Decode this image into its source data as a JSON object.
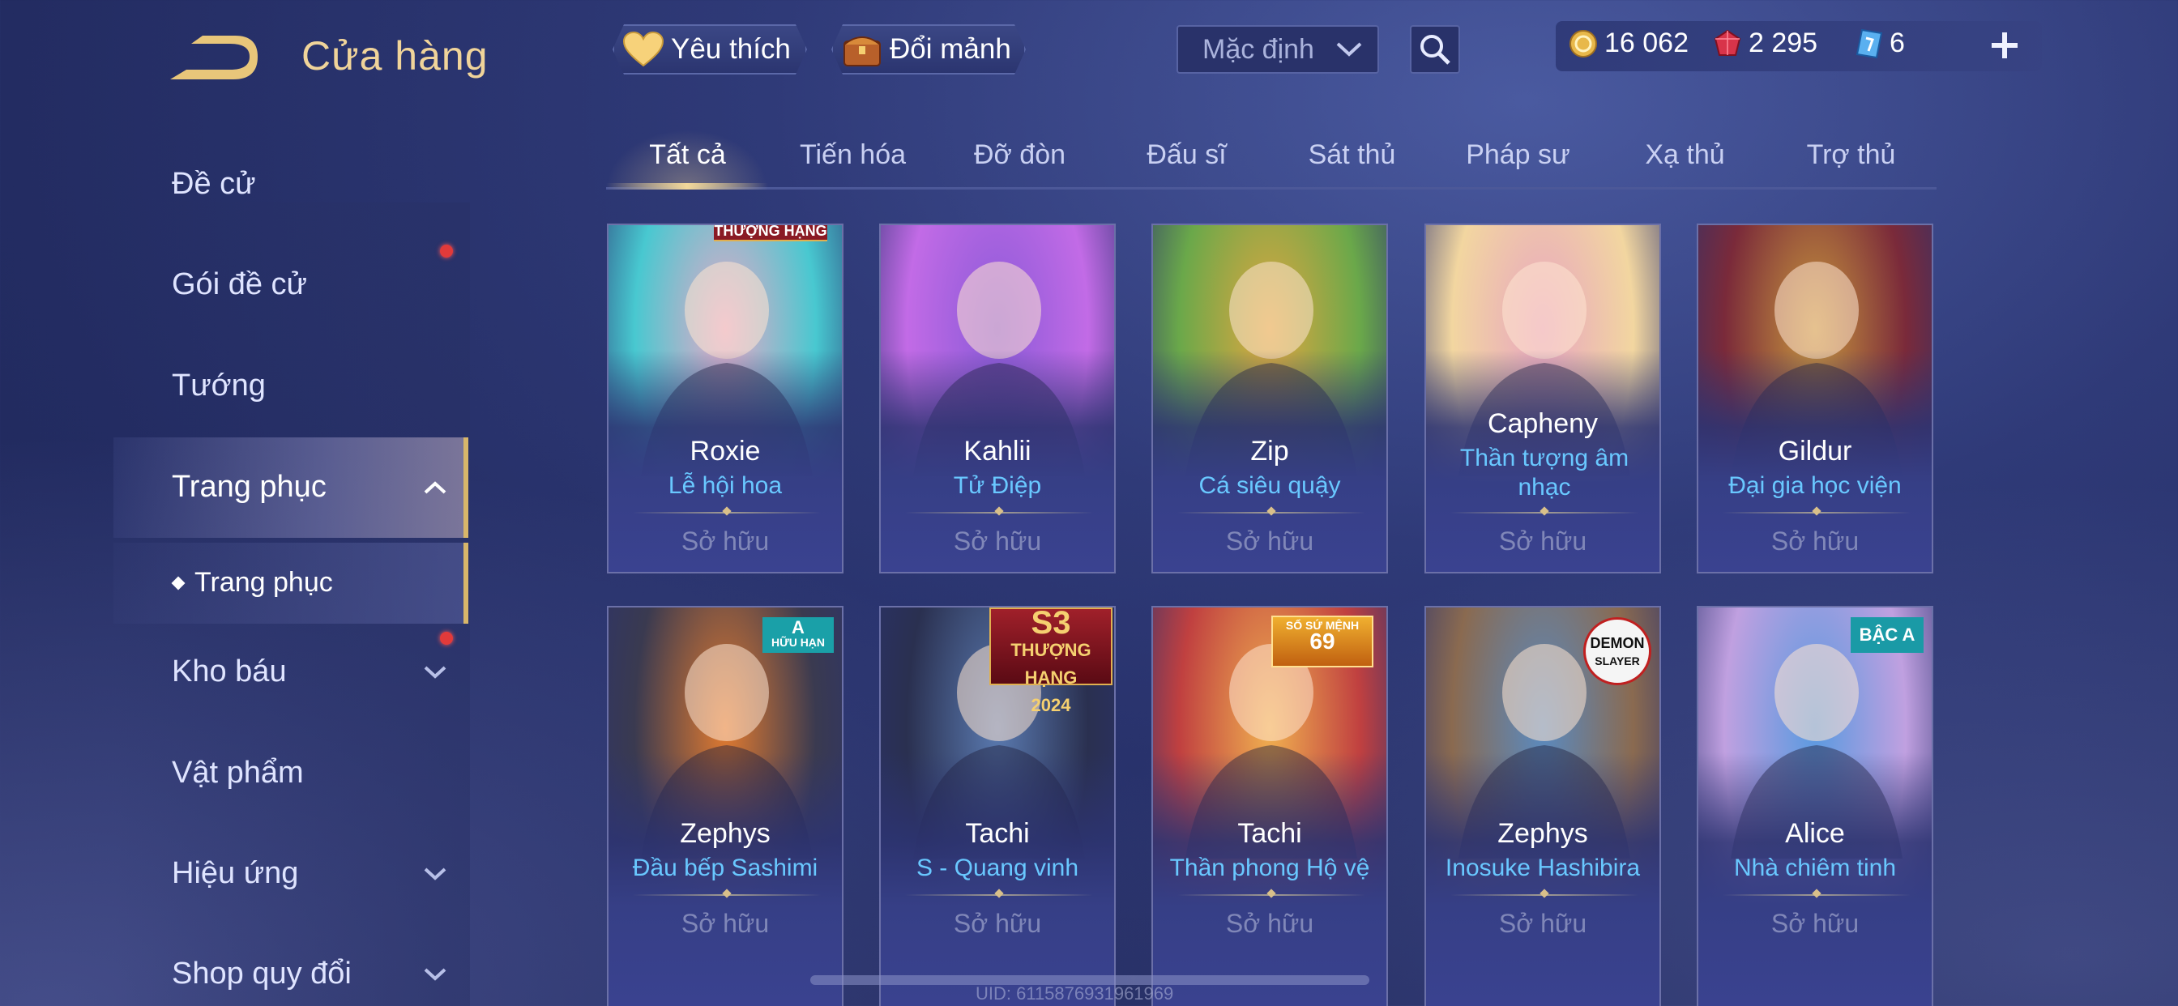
{
  "header": {
    "title": "Cửa hàng",
    "favorites_label": "Yêu thích",
    "exchange_label": "Đổi mảnh",
    "sort_value": "Mặc định",
    "currencies": {
      "gold": "16 062",
      "ruby": "2 295",
      "ticket": "6"
    }
  },
  "sidebar": {
    "items": [
      {
        "label": "Đề cử"
      },
      {
        "label": "Gói đề cử"
      },
      {
        "label": "Tướng"
      },
      {
        "label": "Trang phục"
      },
      {
        "label": "Kho báu"
      },
      {
        "label": "Vật phẩm"
      },
      {
        "label": "Hiệu ứng"
      },
      {
        "label": "Shop quy đổi"
      }
    ],
    "sub_item": "Trang phục"
  },
  "tabs": [
    "Tất cả",
    "Tiến hóa",
    "Đỡ đòn",
    "Đấu sĩ",
    "Sát thủ",
    "Pháp sư",
    "Xạ thủ",
    "Trợ thủ"
  ],
  "cards": [
    {
      "hero": "Roxie",
      "skin": "Lễ hội hoa",
      "status": "Sở hữu",
      "badge": "THƯỢNG HẠNG",
      "colors": [
        "#e7a9c8",
        "#48c8d0"
      ]
    },
    {
      "hero": "Kahlii",
      "skin": "Tử Điệp",
      "status": "Sở hữu",
      "colors": [
        "#8b5ad8",
        "#c26be6"
      ]
    },
    {
      "hero": "Zip",
      "skin": "Cá siêu quậy",
      "status": "Sở hữu",
      "colors": [
        "#e0a640",
        "#6aa84a"
      ]
    },
    {
      "hero": "Capheny",
      "skin": "Thần tượng âm nhạc",
      "status": "Sở hữu",
      "colors": [
        "#e8a6c0",
        "#f2d6a0"
      ]
    },
    {
      "hero": "Gildur",
      "skin": "Đại gia học viện",
      "status": "Sở hữu",
      "colors": [
        "#c7963e",
        "#7a2a3a"
      ]
    },
    {
      "hero": "Zephys",
      "skin": "Đầu bếp Sashimi",
      "status": "Sở hữu",
      "badge_top": "A",
      "badge_bottom": "HỮU HẠN",
      "colors": [
        "#e07a30",
        "#3a3a50"
      ]
    },
    {
      "hero": "Tachi",
      "skin": "S - Quang vinh",
      "status": "Sở hữu",
      "badge_top": "S3",
      "badge_mid": "THƯỢNG HẠNG",
      "badge_bottom": "2024",
      "colors": [
        "#5a7ab0",
        "#2a3050"
      ]
    },
    {
      "hero": "Tachi",
      "skin": "Thần phong Hộ vệ",
      "status": "Sở hữu",
      "badge_top": "SỔ SỨ MỆNH",
      "badge_bottom": "69",
      "colors": [
        "#f0b050",
        "#c04040"
      ]
    },
    {
      "hero": "Zephys",
      "skin": "Inosuke Hashibira",
      "status": "Sở hữu",
      "badge_top": "DEMON",
      "badge_bottom": "SLAYER",
      "colors": [
        "#5a8ac0",
        "#8a6a50"
      ]
    },
    {
      "hero": "Alice",
      "skin": "Nhà chiêm tinh",
      "status": "Sở hữu",
      "badge_top": "BẬC A",
      "colors": [
        "#5a9ae0",
        "#c0a0e0"
      ]
    }
  ],
  "uid": "UID: 6115876931961969"
}
